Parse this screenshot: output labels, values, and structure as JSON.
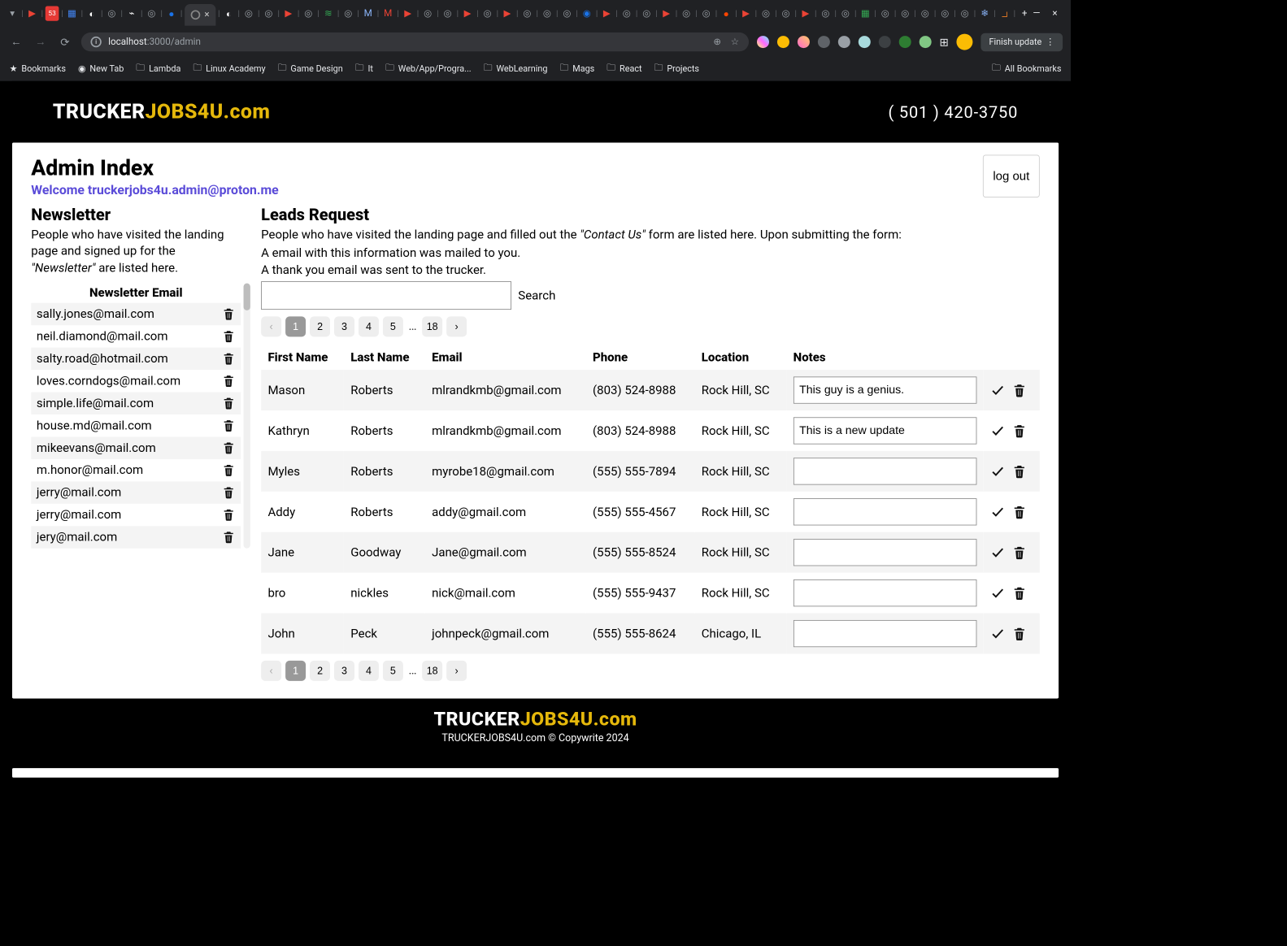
{
  "browser": {
    "url_host": "localhost",
    "url_port_path": ":3000/admin",
    "finish_label": "Finish update",
    "bookmarks_label": "Bookmarks",
    "all_bookmarks_label": "All Bookmarks",
    "bm_items": [
      "New Tab",
      "Lambda",
      "Linux Academy",
      "Game Design",
      "It",
      "Web/App/Progra...",
      "WebLearning",
      "Mags",
      "React",
      "Projects"
    ]
  },
  "brand": {
    "part1": "TRUCKER",
    "part2": "JOBS4U",
    "part3": ".com"
  },
  "phone": "( 501 ) 420-3750",
  "admin": {
    "title": "Admin Index",
    "welcome_prefix": "Welcome ",
    "welcome_email": "truckerjobs4u.admin@proton.me",
    "logout_label": "log out"
  },
  "newsletter": {
    "title": "Newsletter",
    "desc_pre": "People who have visited the landing page and signed up for the ",
    "desc_ital": "\"Newsletter\"",
    "desc_post": " are listed here.",
    "header": "Newsletter Email",
    "emails": [
      "sally.jones@mail.com",
      "neil.diamond@mail.com",
      "salty.road@hotmail.com",
      "loves.corndogs@mail.com",
      "simple.life@mail.com",
      "house.md@mail.com",
      "mikeevans@mail.com",
      "m.honor@mail.com",
      "jerry@mail.com",
      "jerry@mail.com",
      "jery@mail.com"
    ]
  },
  "leads": {
    "title": "Leads Request",
    "desc_pre": "People who have visited the landing page and filled out the ",
    "desc_ital": "\"Contact Us\"",
    "desc_post": " form are listed here. Upon submitting the form:",
    "bullet1": "A email with this information was mailed to you.",
    "bullet2": "A thank you email was sent to the trucker.",
    "search_label": "Search",
    "pages": [
      "1",
      "2",
      "3",
      "4",
      "5"
    ],
    "page_last": "18",
    "columns": [
      "First Name",
      "Last Name",
      "Email",
      "Phone",
      "Location",
      "Notes"
    ],
    "rows": [
      {
        "first": "Mason",
        "last": "Roberts",
        "email": "mlrandkmb@gmail.com",
        "phone": "(803) 524-8988",
        "loc": "Rock Hill, SC",
        "notes": "This guy is a genius."
      },
      {
        "first": "Kathryn",
        "last": "Roberts",
        "email": "mlrandkmb@gmail.com",
        "phone": "(803) 524-8988",
        "loc": "Rock Hill, SC",
        "notes": "This is a new update"
      },
      {
        "first": "Myles",
        "last": "Roberts",
        "email": "myrobe18@gmail.com",
        "phone": "(555) 555-7894",
        "loc": "Rock Hill, SC",
        "notes": ""
      },
      {
        "first": "Addy",
        "last": "Roberts",
        "email": "addy@gmail.com",
        "phone": "(555) 555-4567",
        "loc": "Rock Hill, SC",
        "notes": ""
      },
      {
        "first": "Jane",
        "last": "Goodway",
        "email": "Jane@gmail.com",
        "phone": "(555) 555-8524",
        "loc": "Rock Hill, SC",
        "notes": ""
      },
      {
        "first": "bro",
        "last": "nickles",
        "email": "nick@mail.com",
        "phone": "(555) 555-9437",
        "loc": "Rock Hill, SC",
        "notes": ""
      },
      {
        "first": "John",
        "last": "Peck",
        "email": "johnpeck@gmail.com",
        "phone": "(555) 555-8624",
        "loc": "Chicago, IL",
        "notes": ""
      }
    ]
  },
  "footer": {
    "copy": "TRUCKERJOBS4U.com © Copywrite 2024"
  }
}
